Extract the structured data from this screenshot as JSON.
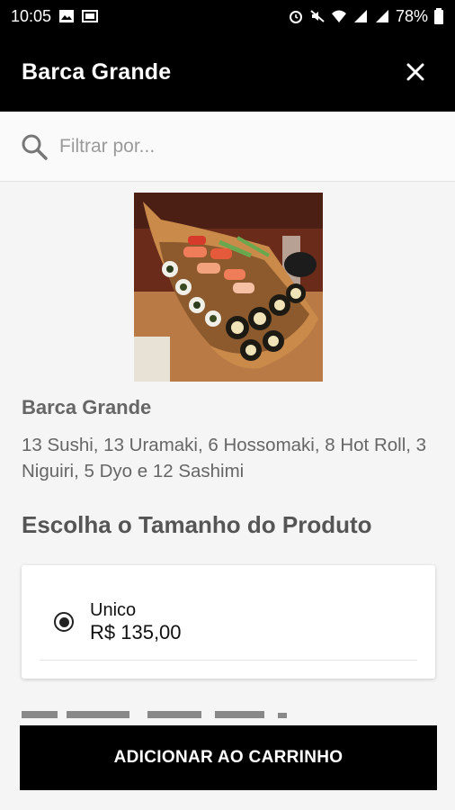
{
  "status_bar": {
    "time": "10:05",
    "battery": "78%"
  },
  "header": {
    "title": "Barca Grande"
  },
  "search": {
    "placeholder": "Filtrar por..."
  },
  "product": {
    "name": "Barca Grande",
    "description": "13 Sushi, 13 Uramaki, 6 Hossomaki, 8 Hot Roll, 3 Niguiri, 5 Dyo e 12 Sashimi"
  },
  "size_section": {
    "title": "Escolha o Tamanho do Produto",
    "options": [
      {
        "name": "Unico",
        "price": "R$ 135,00",
        "selected": true
      }
    ]
  },
  "actions": {
    "add_to_cart_label": "ADICIONAR AO CARRINHO"
  },
  "colors": {
    "bar": "#000000",
    "text_muted": "#666666",
    "background": "#f5f5f5"
  }
}
